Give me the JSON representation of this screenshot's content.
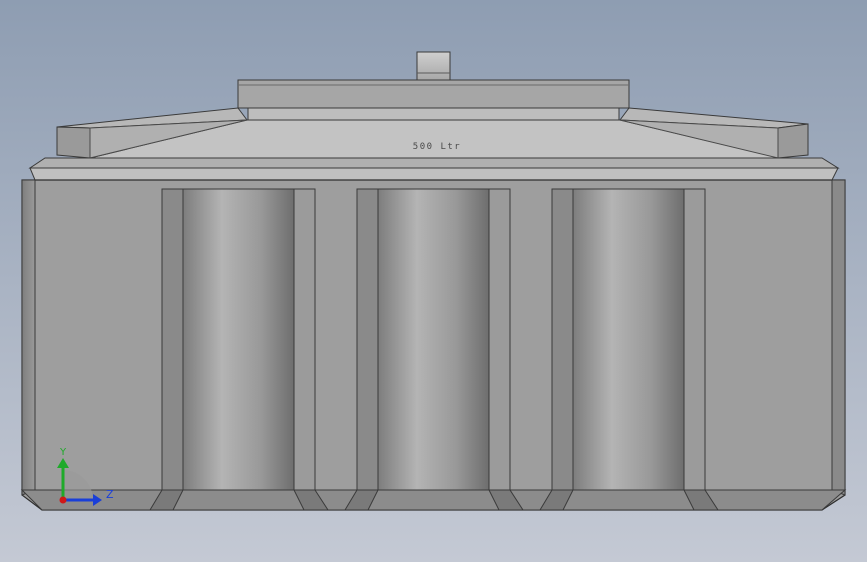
{
  "viewport": {
    "background_top": "#8e9db2",
    "background_bottom": "#c4c9d4",
    "model": "tank-front-view"
  },
  "model": {
    "engraved_text": "500 Ltr"
  },
  "triad": {
    "y_label": "Y",
    "z_label": "Z",
    "y_color": "#1faa2a",
    "z_color": "#1a3fd8",
    "x_color": "#d01818"
  }
}
